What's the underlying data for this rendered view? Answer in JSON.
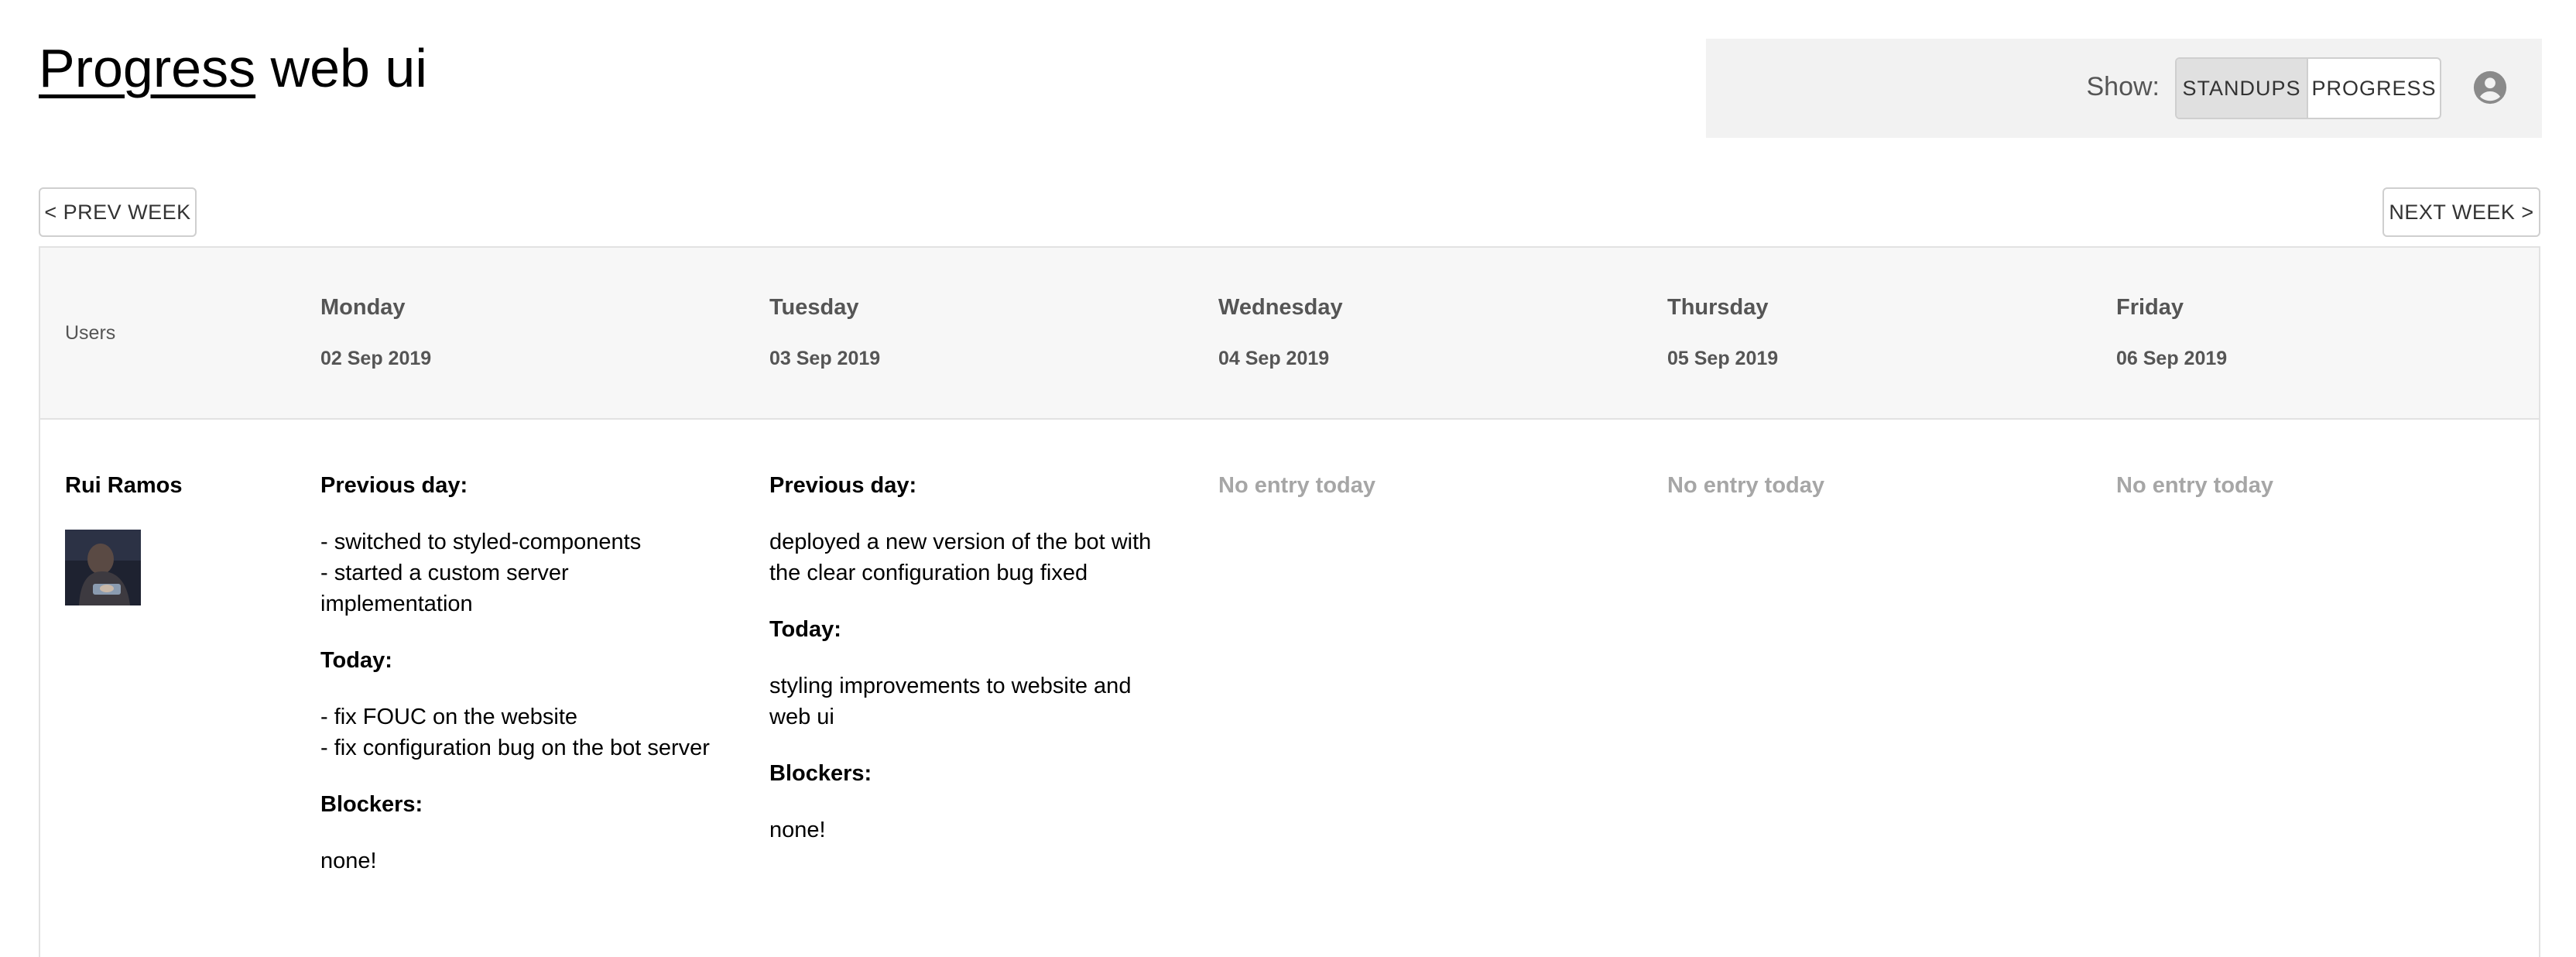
{
  "header": {
    "logo_text": "Progress",
    "title_rest": " web ui"
  },
  "show": {
    "label": "Show:",
    "options": [
      {
        "label": "STANDUPS",
        "active": true
      },
      {
        "label": "PROGRESS",
        "active": false
      }
    ],
    "account_icon": "account-circle-icon"
  },
  "nav": {
    "prev_label": "< PREV WEEK",
    "next_label": "NEXT WEEK >"
  },
  "table": {
    "users_header": "Users",
    "days": [
      {
        "name": "Monday",
        "date": "02 Sep 2019"
      },
      {
        "name": "Tuesday",
        "date": "03 Sep 2019"
      },
      {
        "name": "Wednesday",
        "date": "04 Sep 2019"
      },
      {
        "name": "Thursday",
        "date": "05 Sep 2019"
      },
      {
        "name": "Friday",
        "date": "06 Sep 2019"
      }
    ],
    "rows": [
      {
        "user": "Rui Ramos",
        "entries": [
          {
            "previous_label": "Previous day:",
            "previous": "- switched to styled-components\n- started a custom server implementation",
            "today_label": "Today:",
            "today": "- fix FOUC on the website\n- fix configuration bug on the bot server",
            "blockers_label": "Blockers:",
            "blockers": "none!"
          },
          {
            "previous_label": "Previous day:",
            "previous": "deployed a new version of the bot with the clear configuration bug fixed",
            "today_label": "Today:",
            "today": "styling improvements to website and web ui",
            "blockers_label": "Blockers:",
            "blockers": "none!"
          },
          {
            "no_entry": "No entry today"
          },
          {
            "no_entry": "No entry today"
          },
          {
            "no_entry": "No entry today"
          }
        ]
      }
    ]
  }
}
